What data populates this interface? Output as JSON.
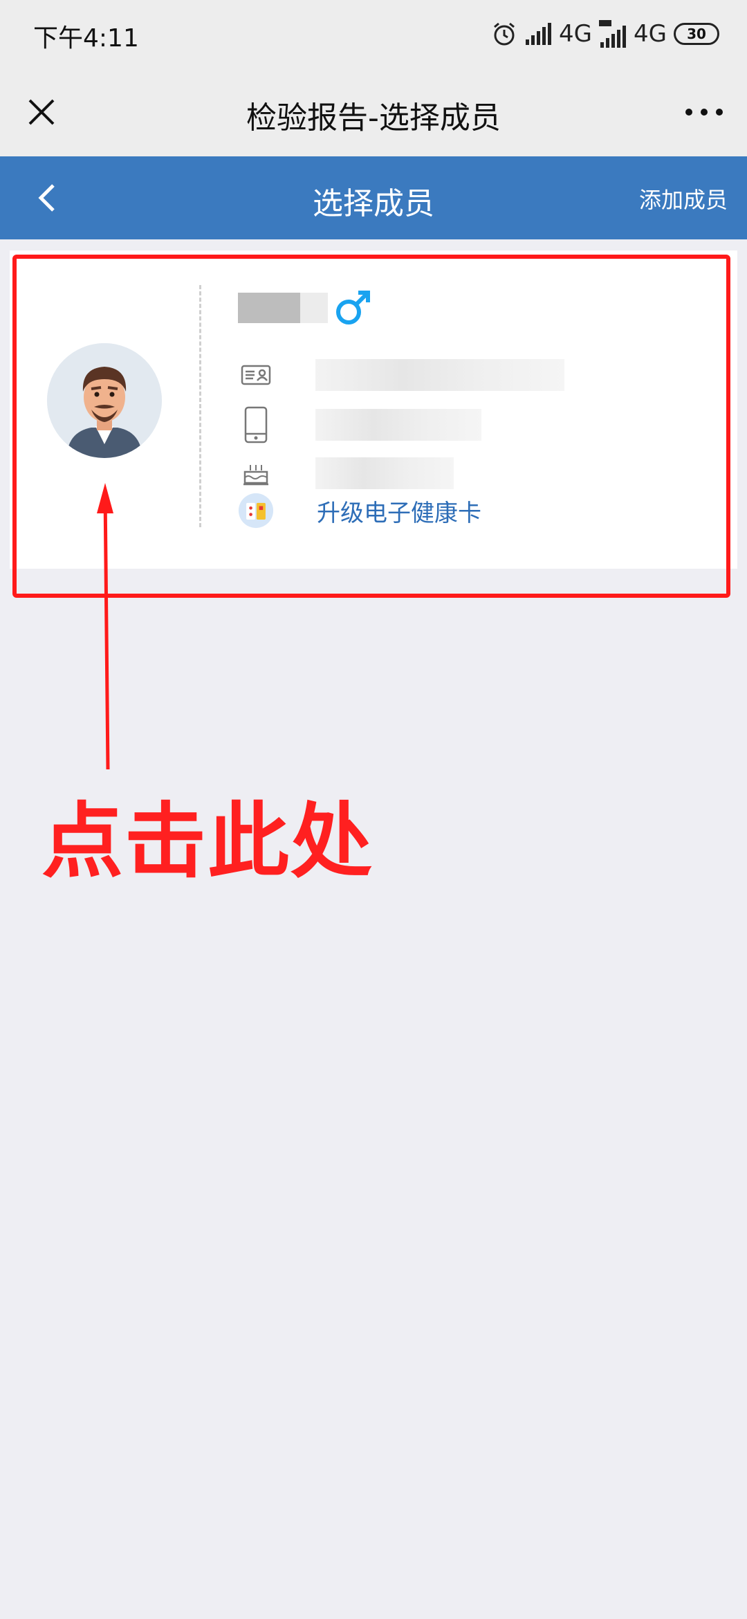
{
  "status_bar": {
    "time": "下午4:11",
    "network_1": "4G",
    "network_2": "4G",
    "battery": "30"
  },
  "title_bar": {
    "title": "检验报告-选择成员"
  },
  "header": {
    "title": "选择成员",
    "add_member": "添加成员",
    "color": "#3b7abf"
  },
  "member_card": {
    "gender_icon": "male-symbol-icon",
    "upgrade_link": "升级电子健康卡"
  },
  "annotation": {
    "label": "点击此处",
    "color": "#ff1a1a"
  }
}
